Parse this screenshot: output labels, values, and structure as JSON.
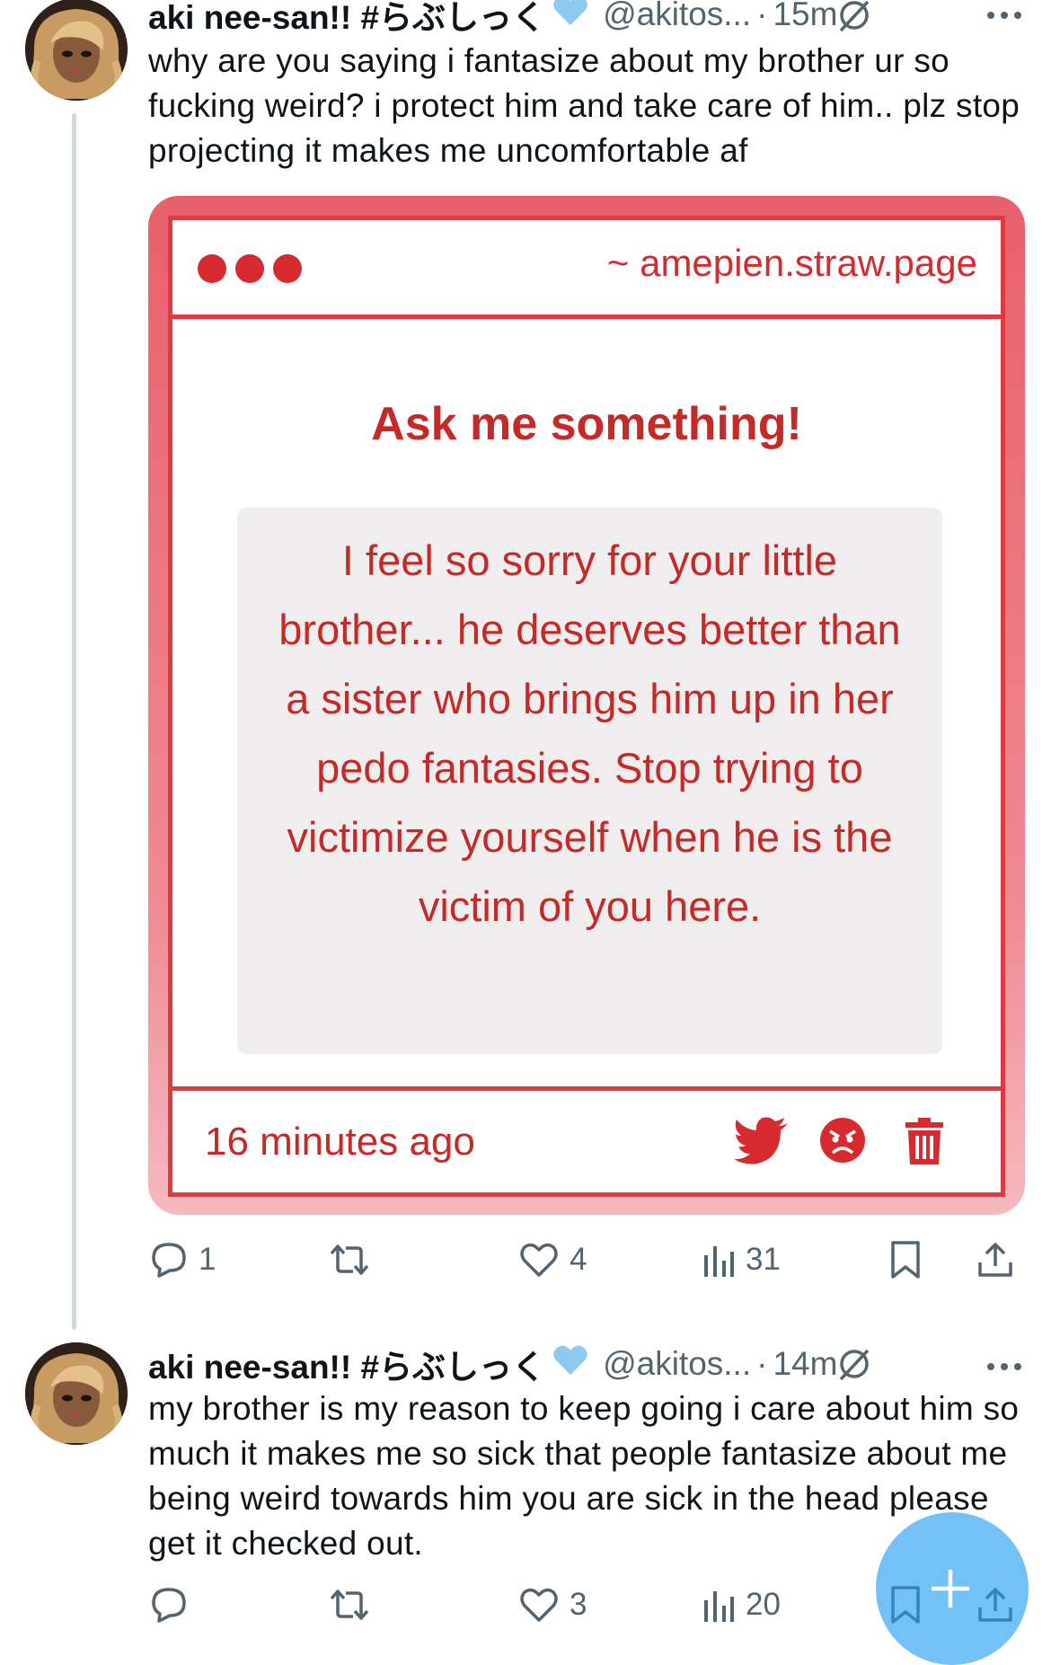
{
  "tweets": [
    {
      "display_name": "aki nee-san!! #らぶしっく",
      "handle": "@akitos...",
      "time": "15m",
      "text": "why are you saying i fantasize about my brother ur so fucking weird? i protect him and take care of him.. plz stop projecting it makes me uncomfortable af",
      "stats": {
        "replies": "1",
        "retweets": "",
        "likes": "4",
        "views": "31"
      }
    },
    {
      "display_name": "aki nee-san!! #らぶしっく",
      "handle": "@akitos...",
      "time": "14m",
      "text": "my brother is my reason to keep going i care about him so much it makes me so sick that people fantasize about me being weird towards him you are sick in the head please get it checked out.",
      "stats": {
        "replies": "",
        "retweets": "",
        "likes": "3",
        "views": "20"
      }
    }
  ],
  "card": {
    "url": "~ amepien.straw.page",
    "title": "Ask me something!",
    "question": "I feel so sorry for your little brother... he deserves better than a sister who brings him up in her pedo fantasies. Stop trying to victimize yourself when he is the victim of you here.",
    "timestamp": "16 minutes ago",
    "icons": [
      "twitter-bird-icon",
      "angry-face-icon",
      "trash-icon"
    ]
  },
  "separator": "·",
  "colors": {
    "card_red": "#d72a2e",
    "card_text": "#c42b28",
    "secondary_text": "#536471",
    "fab_blue": "#1d9bf0",
    "verified_heart": "#8ec9f0"
  }
}
